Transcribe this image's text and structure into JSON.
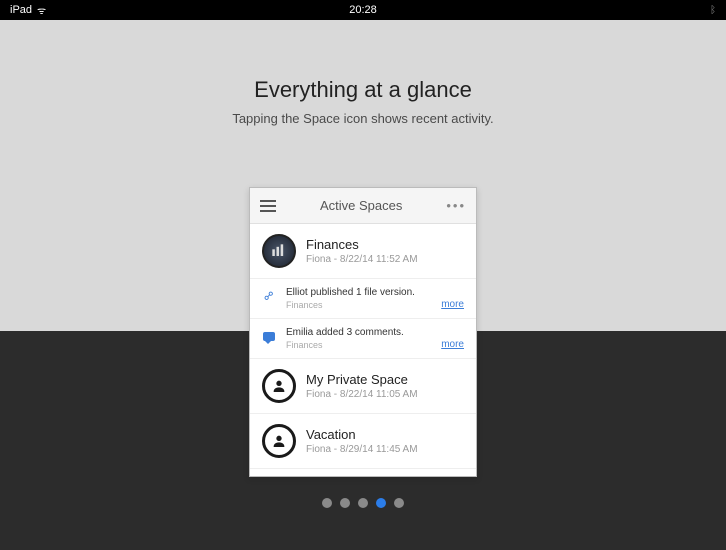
{
  "statusBar": {
    "device": "iPad",
    "time": "20:28"
  },
  "hero": {
    "title": "Everything at a glance",
    "subtitle": "Tapping the Space icon shows recent activity."
  },
  "panel": {
    "title": "Active Spaces",
    "spaces": [
      {
        "name": "Finances",
        "meta": "Fiona - 8/22/14 11:52 AM"
      },
      {
        "name": "My Private Space",
        "meta": "Fiona - 8/22/14 11:05 AM"
      },
      {
        "name": "Vacation",
        "meta": "Fiona - 8/29/14 11:45 AM"
      }
    ],
    "activities": [
      {
        "title": "Elliot published 1 file version.",
        "sub": "Finances",
        "more": "more"
      },
      {
        "title": "Emilia added 3 comments.",
        "sub": "Finances",
        "more": "more"
      }
    ]
  },
  "pager": {
    "total": 5,
    "active": 3
  }
}
